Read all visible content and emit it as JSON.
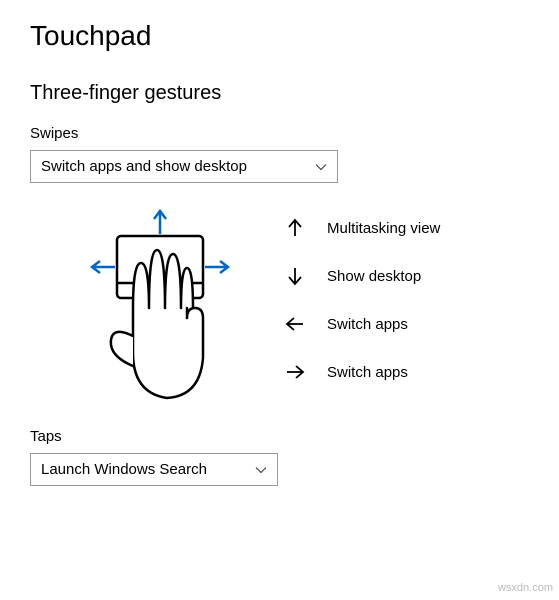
{
  "page": {
    "title": "Touchpad"
  },
  "section": {
    "heading": "Three-finger gestures"
  },
  "swipes": {
    "label": "Swipes",
    "selected": "Switch apps and show desktop"
  },
  "legend": {
    "up": "Multitasking view",
    "down": "Show desktop",
    "left": "Switch apps",
    "right": "Switch apps"
  },
  "taps": {
    "label": "Taps",
    "selected": "Launch Windows Search"
  },
  "watermark": "wsxdn.com"
}
